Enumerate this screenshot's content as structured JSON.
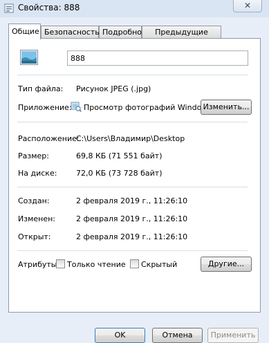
{
  "window": {
    "title": "Свойства: 888",
    "close_glyph": "✕"
  },
  "tabs": [
    {
      "label": "Общие",
      "active": true
    },
    {
      "label": "Безопасность",
      "active": false
    },
    {
      "label": "Подробно",
      "active": false
    },
    {
      "label": "Предыдущие версии",
      "active": false
    }
  ],
  "file": {
    "name": "888",
    "icon": "jpeg-image-icon"
  },
  "type_section": {
    "type_label": "Тип файла:",
    "type_value": "Рисунок JPEG (.jpg)",
    "app_label": "Приложение:",
    "app_value": "Просмотр фотографий Windows",
    "app_icon": "photo-viewer-icon",
    "change_button": "Изменить..."
  },
  "location_section": {
    "location_label": "Расположение:",
    "location_value": "C:\\Users\\Владимир\\Desktop",
    "size_label": "Размер:",
    "size_value": "69,8 КБ (71 551 байт)",
    "disk_label": "На диске:",
    "disk_value": "72,0 КБ (73 728 байт)"
  },
  "dates_section": {
    "created_label": "Создан:",
    "created_value": "2 февраля 2019 г., 11:26:10",
    "modified_label": "Изменен:",
    "modified_value": "2 февраля 2019 г., 11:26:10",
    "accessed_label": "Открыт:",
    "accessed_value": "2 февраля 2019 г., 11:26:10"
  },
  "attributes": {
    "label": "Атрибуты:",
    "readonly_label": "Только чтение",
    "readonly_checked": false,
    "hidden_label": "Скрытый",
    "hidden_checked": false,
    "other_button": "Другие..."
  },
  "footer": {
    "ok": "OK",
    "cancel": "Отмена",
    "apply": "Применить"
  }
}
